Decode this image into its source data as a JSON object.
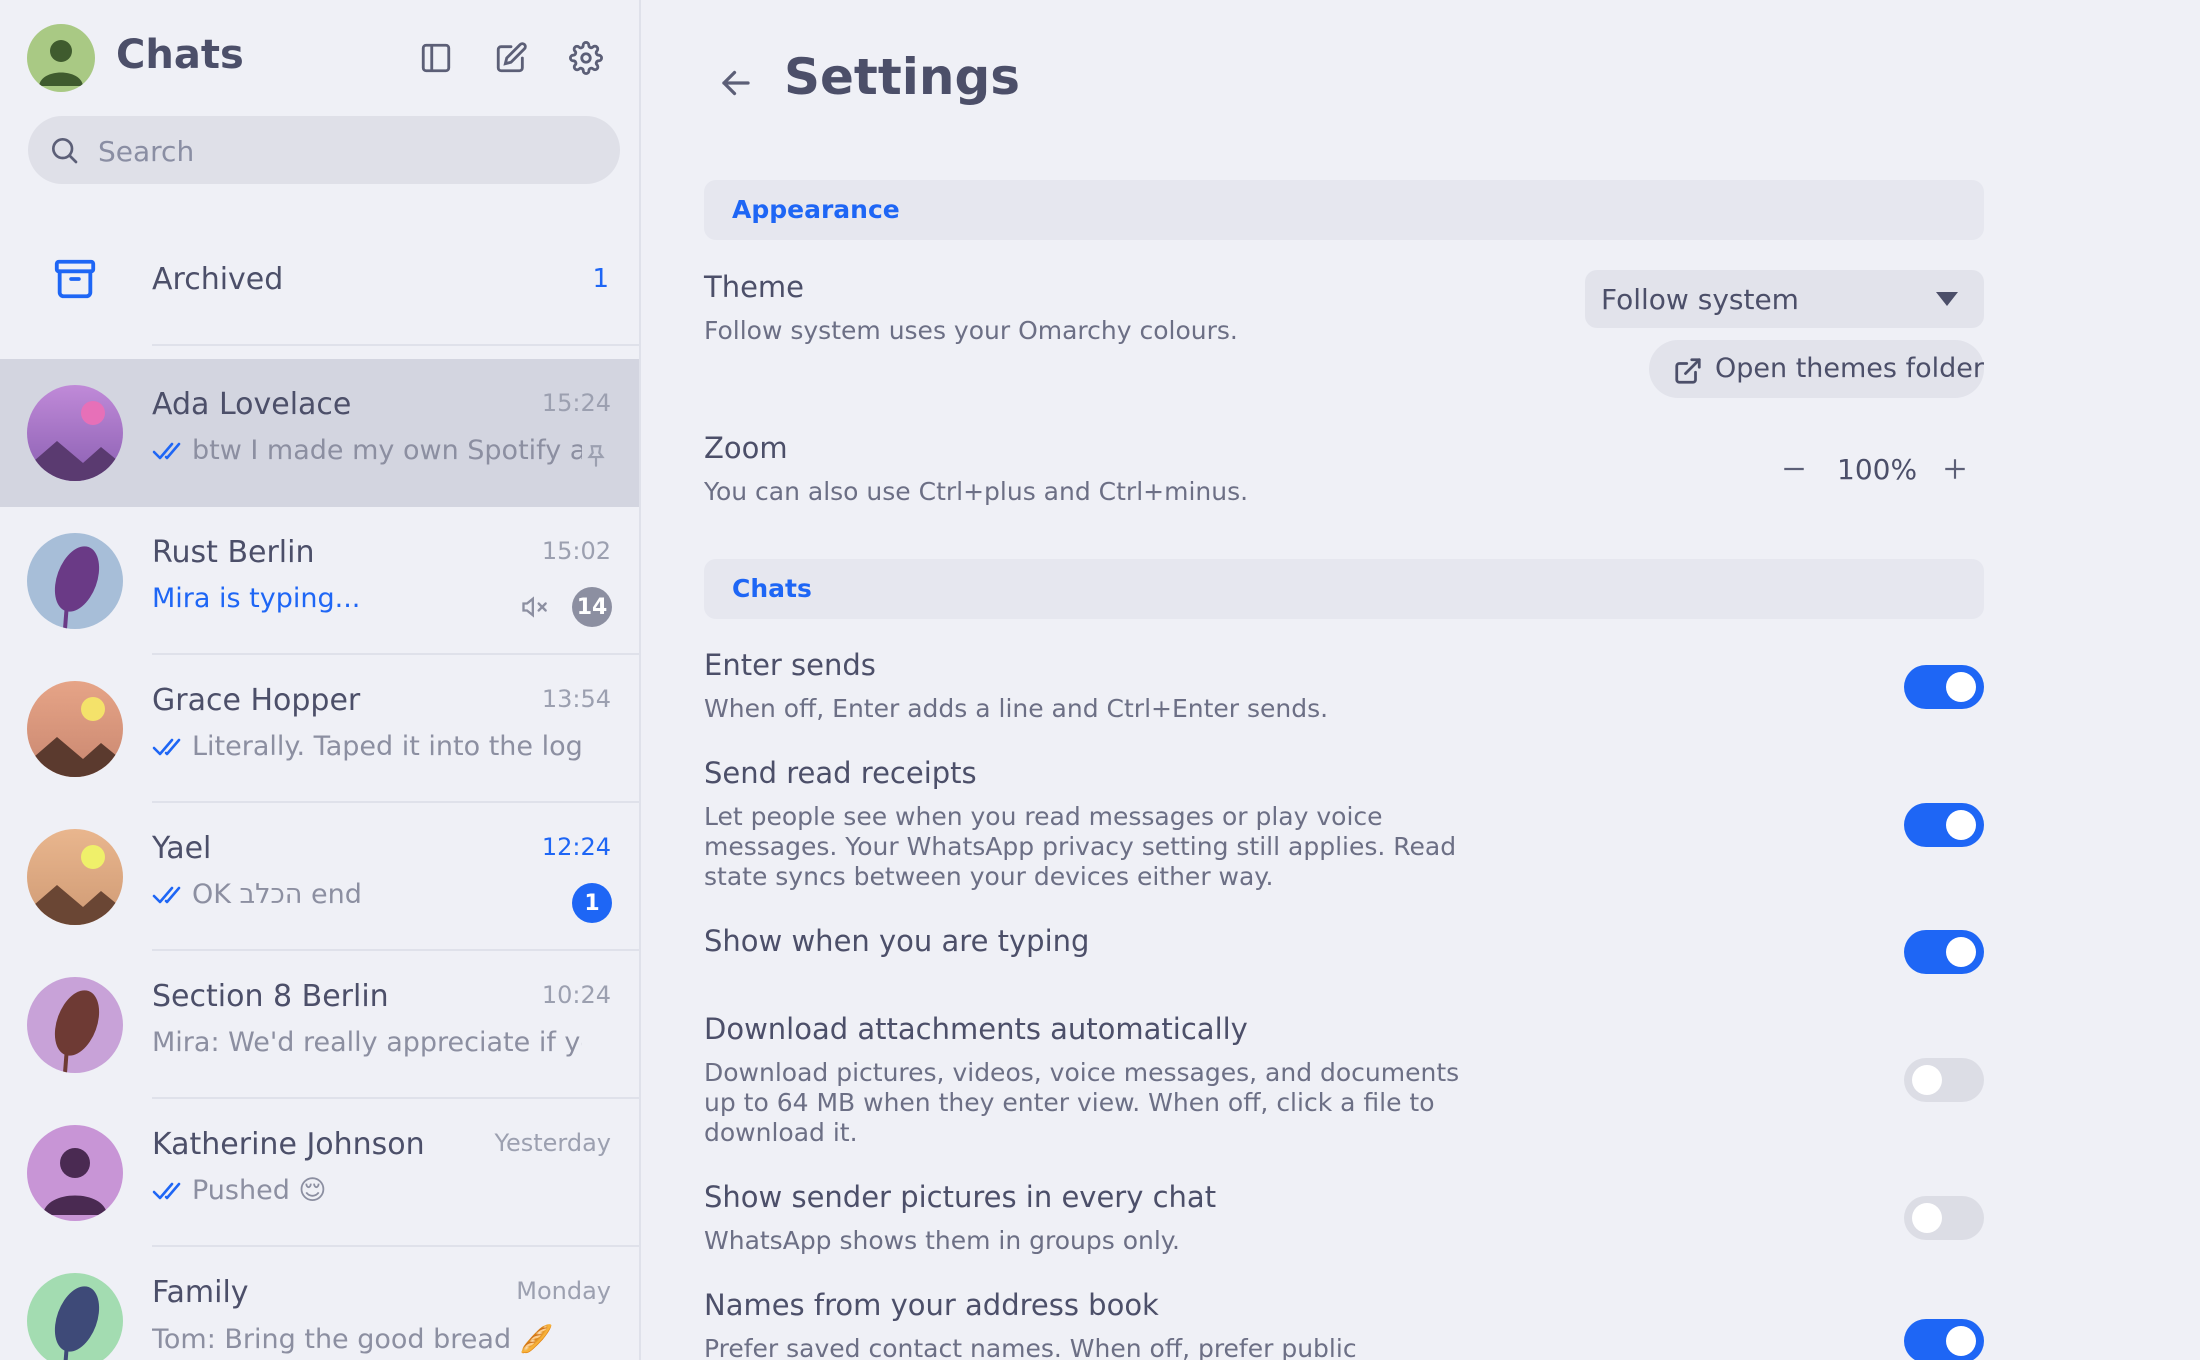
{
  "sidebar": {
    "title": "Chats",
    "search_placeholder": "Search",
    "archived": {
      "label": "Archived",
      "count": "1"
    },
    "chats": [
      {
        "name": "Ada Lovelace",
        "time": "15:24",
        "preview": "btw I made my own Spotify a...",
        "read": true,
        "pinned": true,
        "selected": true
      },
      {
        "name": "Rust Berlin",
        "time": "15:02",
        "preview": "Mira is typing...",
        "typing": true,
        "muted": true,
        "badge": "14"
      },
      {
        "name": "Grace Hopper",
        "time": "13:54",
        "preview": "Literally. Taped it into the logbo...",
        "read": true
      },
      {
        "name": "Yael",
        "time": "12:24",
        "time_accent": true,
        "preview": "OK הכלב end",
        "read": true,
        "badge": "1"
      },
      {
        "name": "Section 8 Berlin",
        "time": "10:24",
        "preview": "Mira: We'd really appreciate if you ..."
      },
      {
        "name": "Katherine Johnson",
        "time": "Yesterday",
        "preview": "Pushed 😌",
        "read": true
      },
      {
        "name": "Family",
        "time": "Monday",
        "preview": "Tom: Bring the good bread 🥖"
      }
    ]
  },
  "settings": {
    "title": "Settings",
    "appearance": {
      "section": "Appearance",
      "theme_title": "Theme",
      "theme_desc": "Follow system uses your Omarchy colours.",
      "theme_value": "Follow system",
      "open_themes": "Open themes folder",
      "zoom_title": "Zoom",
      "zoom_desc": "You can also use Ctrl+plus and Ctrl+minus.",
      "zoom_value": "100%"
    },
    "chats": {
      "section": "Chats",
      "items": [
        {
          "title": "Enter sends",
          "desc": "When off, Enter adds a line and Ctrl+Enter sends.",
          "on": true
        },
        {
          "title": "Send read receipts",
          "desc": "Let people see when you read messages or play voice messages. Your WhatsApp privacy setting still applies. Read state syncs between your devices either way.",
          "on": true
        },
        {
          "title": "Show when you are typing",
          "desc": "",
          "on": true
        },
        {
          "title": "Download attachments automatically",
          "desc": "Download pictures, videos, voice messages, and documents up to 64 MB when they enter view. When off, click a file to download it.",
          "on": false
        },
        {
          "title": "Show sender pictures in every chat",
          "desc": "WhatsApp shows them in groups only.",
          "on": false
        },
        {
          "title": "Names from your address book",
          "desc": "Prefer saved contact names. When off, prefer public WhatsApp",
          "on": true
        }
      ]
    }
  },
  "colors": {
    "accent": "#1e66f5",
    "text": "#4c4f69",
    "muted": "#8c8fa1",
    "background": "#eff0f6"
  }
}
